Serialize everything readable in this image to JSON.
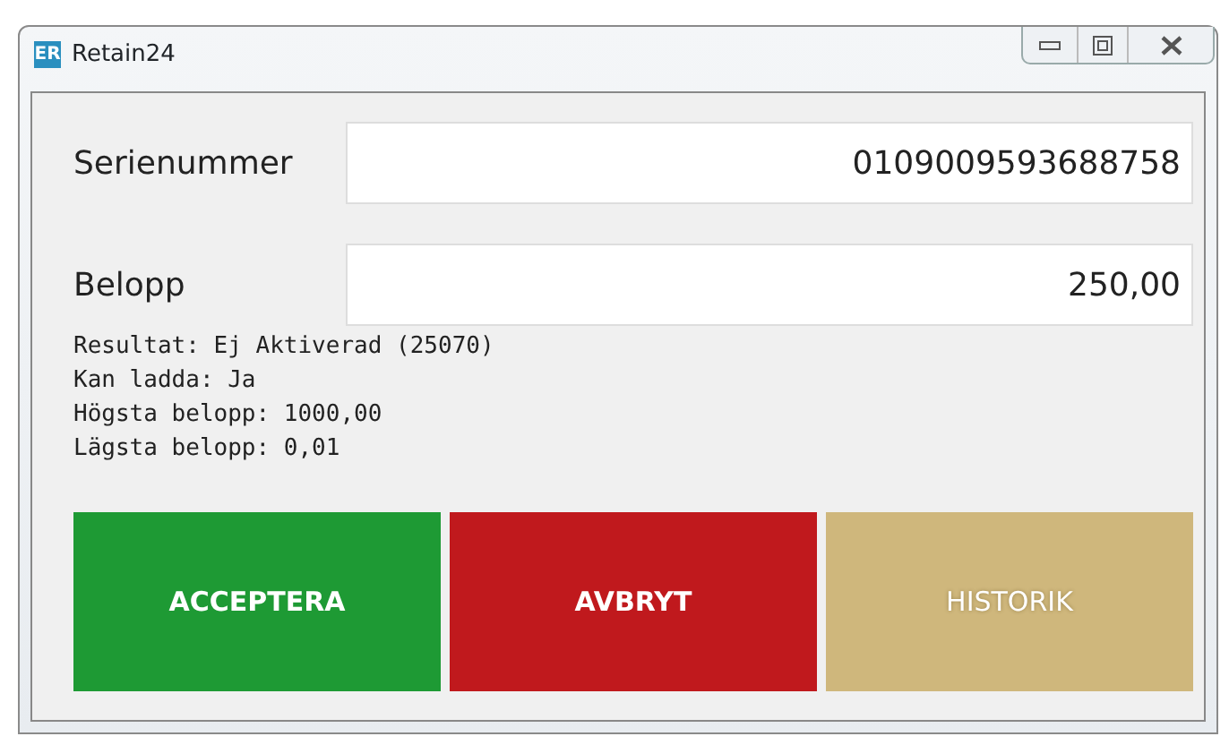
{
  "window": {
    "icon_text": "ER",
    "title": "Retain24"
  },
  "fields": [
    {
      "label": "Serienummer",
      "value": "0109009593688758"
    },
    {
      "label": "Belopp",
      "value": "250,00"
    }
  ],
  "info_lines": [
    "Resultat: Ej Aktiverad (25070)",
    "Kan ladda: Ja",
    "Högsta belopp: 1000,00",
    "Lägsta belopp: 0,01"
  ],
  "buttons": [
    {
      "label": "ACCEPTERA",
      "color": "#1e9a34",
      "disabled": false
    },
    {
      "label": "AVBRYT",
      "color": "#c0191d",
      "disabled": false
    },
    {
      "label": "HISTORIK",
      "color": "#cfb77c",
      "disabled": true
    }
  ]
}
